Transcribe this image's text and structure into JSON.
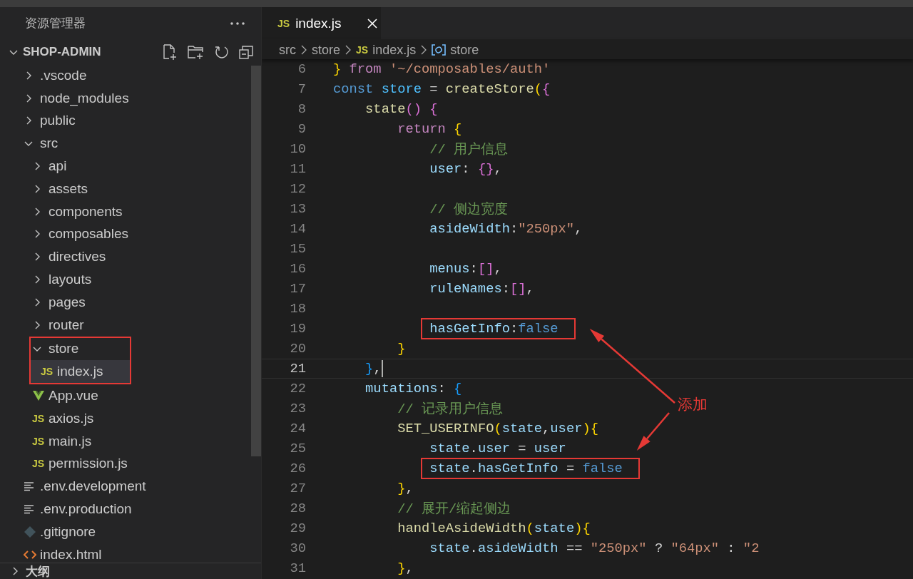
{
  "explorer": {
    "title": "资源管理器",
    "project": {
      "name": "SHOP-ADMIN",
      "expanded": true
    },
    "tree": [
      {
        "label": ".vscode",
        "kind": "folder",
        "expanded": false,
        "selected": false,
        "boxed": false
      },
      {
        "label": "node_modules",
        "kind": "folder",
        "expanded": false,
        "selected": false,
        "boxed": false
      },
      {
        "label": "public",
        "kind": "folder",
        "expanded": false,
        "selected": false,
        "boxed": false
      },
      {
        "label": "src",
        "kind": "folder",
        "expanded": true,
        "selected": false,
        "boxed": false,
        "children": [
          {
            "label": "api",
            "kind": "folder",
            "expanded": false,
            "selected": false,
            "boxed": false
          },
          {
            "label": "assets",
            "kind": "folder",
            "expanded": false,
            "selected": false,
            "boxed": false
          },
          {
            "label": "components",
            "kind": "folder",
            "expanded": false,
            "selected": false,
            "boxed": false
          },
          {
            "label": "composables",
            "kind": "folder",
            "expanded": false,
            "selected": false,
            "boxed": false
          },
          {
            "label": "directives",
            "kind": "folder",
            "expanded": false,
            "selected": false,
            "boxed": false
          },
          {
            "label": "layouts",
            "kind": "folder",
            "expanded": false,
            "selected": false,
            "boxed": false
          },
          {
            "label": "pages",
            "kind": "folder",
            "expanded": false,
            "selected": false,
            "boxed": false
          },
          {
            "label": "router",
            "kind": "folder",
            "expanded": false,
            "selected": false,
            "boxed": false
          },
          {
            "label": "store",
            "kind": "folder",
            "expanded": true,
            "selected": false,
            "boxed": true,
            "children": [
              {
                "label": "index.js",
                "kind": "js",
                "badge": "JS",
                "selected": true,
                "boxed": false
              }
            ]
          },
          {
            "label": "App.vue",
            "kind": "vue",
            "selected": false,
            "boxed": false
          },
          {
            "label": "axios.js",
            "kind": "js",
            "badge": "JS",
            "selected": false,
            "boxed": false
          },
          {
            "label": "main.js",
            "kind": "js",
            "badge": "JS",
            "selected": false,
            "boxed": false
          },
          {
            "label": "permission.js",
            "kind": "js",
            "badge": "JS",
            "selected": false,
            "boxed": false
          }
        ]
      },
      {
        "label": ".env.development",
        "kind": "text",
        "selected": false,
        "boxed": false
      },
      {
        "label": ".env.production",
        "kind": "text",
        "selected": false,
        "boxed": false
      },
      {
        "label": ".gitignore",
        "kind": "git",
        "selected": false,
        "boxed": false
      },
      {
        "label": "index.html",
        "kind": "html",
        "selected": false,
        "boxed": false
      }
    ],
    "outline": {
      "title": "大纲",
      "expanded": false
    }
  },
  "editor": {
    "tabs": [
      {
        "badge": "JS",
        "label": "index.js",
        "selected": true
      }
    ],
    "breadcrumb": [
      {
        "label": "src",
        "kind": "folder"
      },
      {
        "label": "store",
        "kind": "folder"
      },
      {
        "label": "index.js",
        "kind": "file",
        "badge": "JS"
      },
      {
        "label": "store",
        "kind": "symbol"
      }
    ],
    "lines": [
      {
        "n": "6",
        "current": false,
        "boxed": false,
        "tokens": [
          {
            "text": "} ",
            "kind": "b1"
          },
          {
            "text": "from",
            "kind": "ctl"
          },
          {
            "text": " '~/composables/auth'",
            "kind": "str"
          }
        ]
      },
      {
        "n": "7",
        "current": false,
        "boxed": false,
        "tokens": [
          {
            "text": "const",
            "kind": "kw"
          },
          {
            "text": " store",
            "kind": "cst"
          },
          {
            "text": " = ",
            "kind": "p"
          },
          {
            "text": "createStore",
            "kind": "fn"
          },
          {
            "text": "(",
            "kind": "b1"
          },
          {
            "text": "{",
            "kind": "b2"
          }
        ]
      },
      {
        "n": "8",
        "current": false,
        "boxed": false,
        "tokens": [
          {
            "text": "    state",
            "kind": "fn"
          },
          {
            "text": "() {",
            "kind": "b2"
          }
        ]
      },
      {
        "n": "9",
        "current": false,
        "boxed": false,
        "tokens": [
          {
            "text": "        return",
            "kind": "ctl"
          },
          {
            "text": " {",
            "kind": "b1"
          }
        ]
      },
      {
        "n": "10",
        "current": false,
        "boxed": false,
        "tokens": [
          {
            "text": "            // 用户信息",
            "kind": "com"
          }
        ]
      },
      {
        "n": "11",
        "current": false,
        "boxed": false,
        "tokens": [
          {
            "text": "            user",
            "kind": "var"
          },
          {
            "text": ": ",
            "kind": "p"
          },
          {
            "text": "{}",
            "kind": "b2"
          },
          {
            "text": ",",
            "kind": "p"
          }
        ]
      },
      {
        "n": "12",
        "current": false
      },
      {
        "n": "13",
        "current": false,
        "boxed": false,
        "tokens": [
          {
            "text": "            // 侧边宽度",
            "kind": "com"
          }
        ]
      },
      {
        "n": "14",
        "current": false,
        "boxed": false,
        "tokens": [
          {
            "text": "            asideWidth",
            "kind": "var"
          },
          {
            "text": ":",
            "kind": "p"
          },
          {
            "text": "\"250px\"",
            "kind": "str"
          },
          {
            "text": ",",
            "kind": "p"
          }
        ]
      },
      {
        "n": "15",
        "current": false
      },
      {
        "n": "16",
        "current": false,
        "boxed": false,
        "tokens": [
          {
            "text": "            menus",
            "kind": "var"
          },
          {
            "text": ":",
            "kind": "p"
          },
          {
            "text": "[]",
            "kind": "b2"
          },
          {
            "text": ",",
            "kind": "p"
          }
        ]
      },
      {
        "n": "17",
        "current": false,
        "boxed": false,
        "tokens": [
          {
            "text": "            ruleNames",
            "kind": "var"
          },
          {
            "text": ":",
            "kind": "p"
          },
          {
            "text": "[]",
            "kind": "b2"
          },
          {
            "text": ",",
            "kind": "p"
          }
        ]
      },
      {
        "n": "18",
        "current": false
      },
      {
        "n": "19",
        "current": false,
        "boxed": true,
        "tokens": [
          {
            "text": "            hasGetInfo",
            "kind": "var"
          },
          {
            "text": ":",
            "kind": "p"
          },
          {
            "text": "false",
            "kind": "kw"
          }
        ]
      },
      {
        "n": "20",
        "current": false,
        "boxed": false,
        "tokens": [
          {
            "text": "        }",
            "kind": "b1"
          }
        ]
      },
      {
        "n": "21",
        "current": true,
        "boxed": false,
        "tokens": [
          {
            "text": "    }",
            "kind": "b3"
          },
          {
            "text": ",",
            "kind": "p"
          }
        ]
      },
      {
        "n": "22",
        "current": false,
        "boxed": false,
        "tokens": [
          {
            "text": "    mutations",
            "kind": "var"
          },
          {
            "text": ": ",
            "kind": "p"
          },
          {
            "text": "{",
            "kind": "b3"
          }
        ]
      },
      {
        "n": "23",
        "current": false,
        "boxed": false,
        "tokens": [
          {
            "text": "        // 记录用户信息",
            "kind": "com"
          }
        ]
      },
      {
        "n": "24",
        "current": false,
        "boxed": false,
        "tokens": [
          {
            "text": "        SET_USERINFO",
            "kind": "fn"
          },
          {
            "text": "(",
            "kind": "b1"
          },
          {
            "text": "state",
            "kind": "var"
          },
          {
            "text": ",",
            "kind": "p"
          },
          {
            "text": "user",
            "kind": "var"
          },
          {
            "text": "){",
            "kind": "b1"
          }
        ]
      },
      {
        "n": "25",
        "current": false,
        "boxed": false,
        "tokens": [
          {
            "text": "            state",
            "kind": "var"
          },
          {
            "text": ".",
            "kind": "p"
          },
          {
            "text": "user",
            "kind": "var"
          },
          {
            "text": " = ",
            "kind": "p"
          },
          {
            "text": "user",
            "kind": "var"
          }
        ]
      },
      {
        "n": "26",
        "current": false,
        "boxed": true,
        "tokens": [
          {
            "text": "            state",
            "kind": "var"
          },
          {
            "text": ".",
            "kind": "p"
          },
          {
            "text": "hasGetInfo",
            "kind": "var"
          },
          {
            "text": " = ",
            "kind": "p"
          },
          {
            "text": "false",
            "kind": "kw"
          }
        ]
      },
      {
        "n": "27",
        "current": false,
        "boxed": false,
        "tokens": [
          {
            "text": "        }",
            "kind": "b1"
          },
          {
            "text": ",",
            "kind": "p"
          }
        ]
      },
      {
        "n": "28",
        "current": false,
        "boxed": false,
        "tokens": [
          {
            "text": "        // 展开/缩起侧边",
            "kind": "com"
          }
        ]
      },
      {
        "n": "29",
        "current": false,
        "boxed": false,
        "tokens": [
          {
            "text": "        handleAsideWidth",
            "kind": "fn"
          },
          {
            "text": "(",
            "kind": "b1"
          },
          {
            "text": "state",
            "kind": "var"
          },
          {
            "text": "){",
            "kind": "b1"
          }
        ]
      },
      {
        "n": "30",
        "current": false,
        "boxed": false,
        "tokens": [
          {
            "text": "            state",
            "kind": "var"
          },
          {
            "text": ".",
            "kind": "p"
          },
          {
            "text": "asideWidth",
            "kind": "var"
          },
          {
            "text": " == ",
            "kind": "p"
          },
          {
            "text": "\"250px\"",
            "kind": "str"
          },
          {
            "text": " ? ",
            "kind": "p"
          },
          {
            "text": "\"64px\"",
            "kind": "str"
          },
          {
            "text": " : ",
            "kind": "p"
          },
          {
            "text": "\"2",
            "kind": "str"
          }
        ]
      },
      {
        "n": "31",
        "current": false,
        "boxed": false,
        "tokens": [
          {
            "text": "        }",
            "kind": "b1"
          },
          {
            "text": ",",
            "kind": "p"
          }
        ]
      }
    ],
    "annotation": {
      "label": "添加"
    }
  }
}
